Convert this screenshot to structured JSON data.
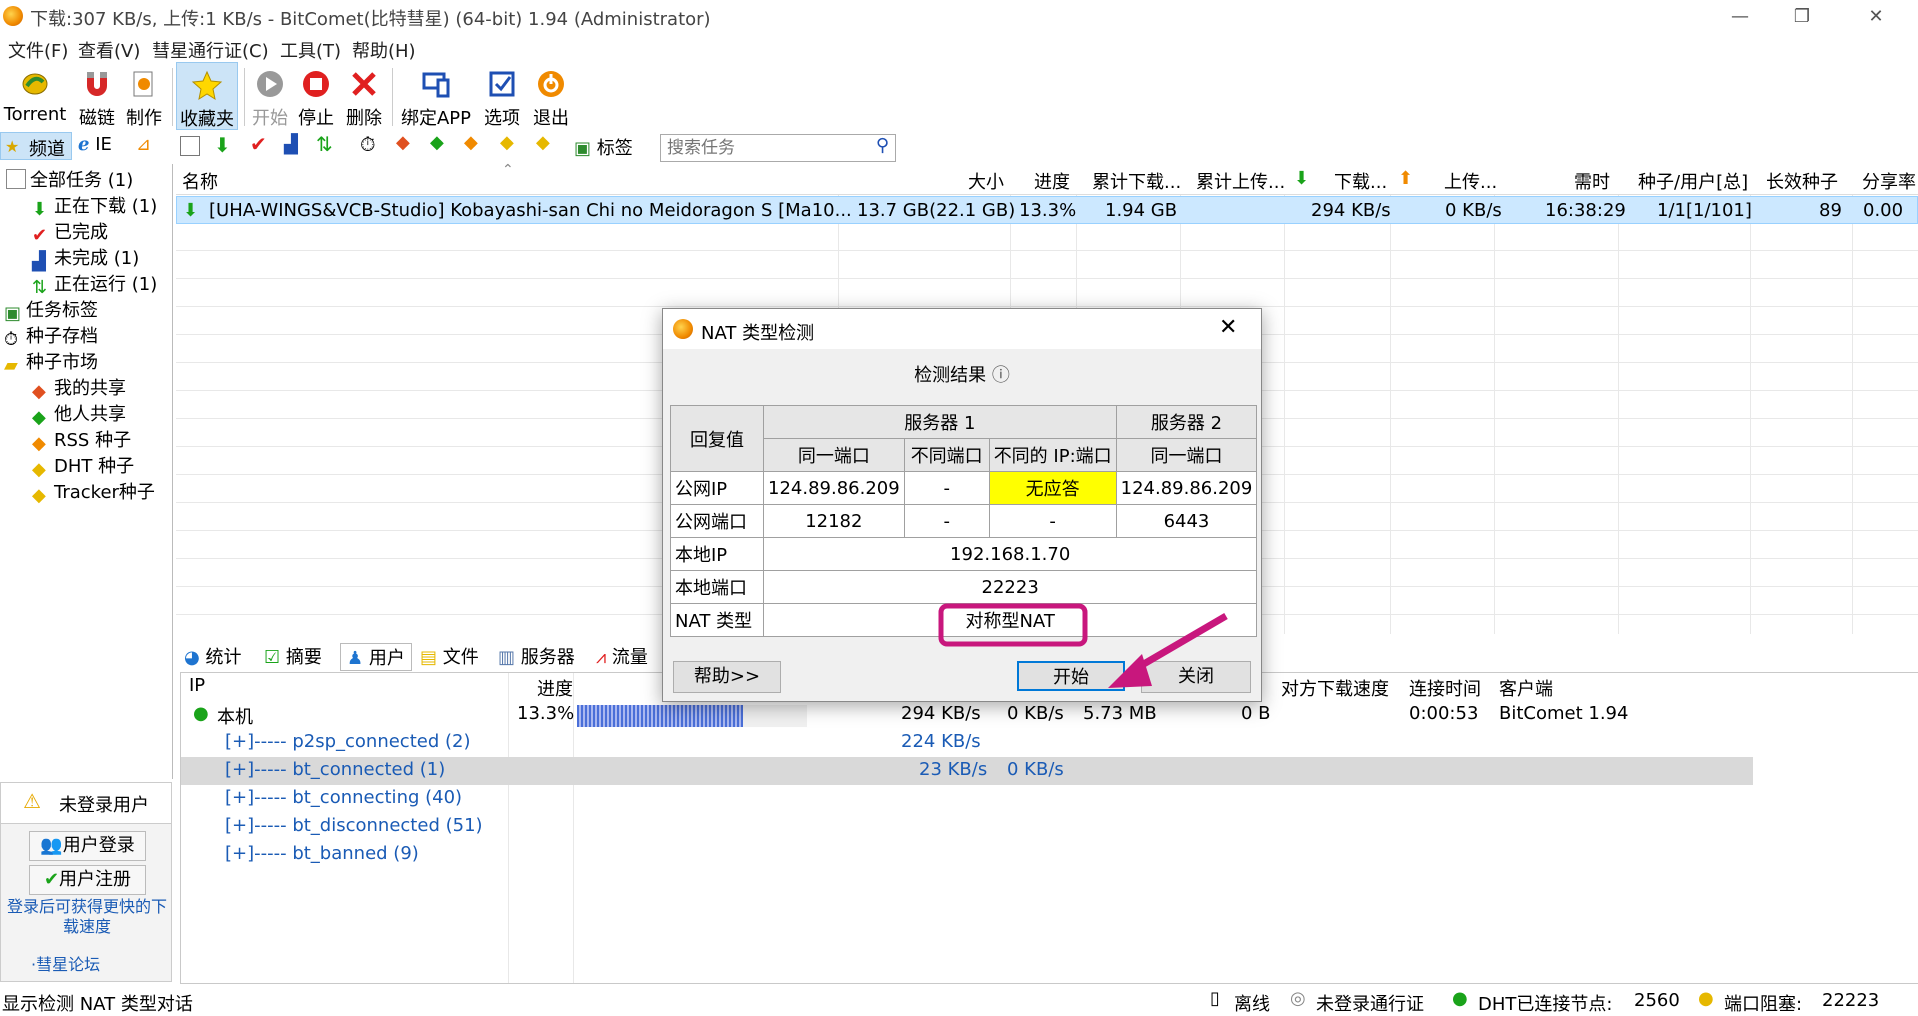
{
  "window": {
    "title": "下载:307 KB/s, 上传:1 KB/s - BitComet(比特彗星) (64-bit) 1.94 (Administrator)",
    "minimize": "—",
    "restore": "❐",
    "close": "✕"
  },
  "menu": [
    "文件(F)",
    "查看(V)",
    "彗星通行证(C)",
    "工具(T)",
    "帮助(H)"
  ],
  "toolbar": {
    "torrent": "Torrent",
    "magnet": "磁链",
    "make": "制作",
    "favorites": "收藏夹",
    "start": "开始",
    "stop": "停止",
    "delete": "删除",
    "bind_app": "绑定APP",
    "options": "选项",
    "exit": "退出"
  },
  "subtoolbar": {
    "channel": "频道",
    "ie": "IE",
    "tag": "标签",
    "search_placeholder": "搜索任务"
  },
  "tree": {
    "all": "全部任务 (1)",
    "downloading": "正在下载 (1)",
    "completed": "已完成",
    "incomplete": "未完成 (1)",
    "running": "正在运行 (1)",
    "task_tags": "任务标签",
    "archive": "种子存档",
    "market": "种子市场",
    "my_share": "我的共享",
    "others_share": "他人共享",
    "rss": "RSS 种子",
    "dht": "DHT 种子",
    "tracker": "Tracker种子"
  },
  "columns": {
    "name": "名称",
    "size": "大小",
    "progress": "进度",
    "total_down": "累计下载...",
    "total_up": "累计上传...",
    "down": "下载...",
    "up": "上传...",
    "eta": "需时",
    "seeds": "种子/用户[总]",
    "long_seeds": "长效种子",
    "ratio": "分享率"
  },
  "task": {
    "name": "[UHA-WINGS&VCB-Studio] Kobayashi-san Chi no Meidoragon S [Ma10...",
    "size": "13.7 GB(22.1 GB)",
    "progress": "13.3%",
    "total_down": "1.94 GB",
    "down": "294 KB/s",
    "up": "0 KB/s",
    "eta": "16:38:29",
    "seeds": "1/1[1/101]",
    "long_seeds": "89",
    "ratio": "0.00"
  },
  "bottom_tabs": [
    "统计",
    "摘要",
    "用户",
    "文件",
    "服务器",
    "流量"
  ],
  "peer_columns": {
    "ip": "IP",
    "progress": "进度",
    "peer_down": "对方下载速度",
    "conn_time": "连接时间",
    "client": "客户端"
  },
  "peers": {
    "local": {
      "name": "本机",
      "progress": "13.3%",
      "down": "294 KB/s",
      "up": "0 KB/s",
      "total": "5.73 MB",
      "zero": "0 B",
      "time": "0:00:53",
      "client": "BitComet 1.94",
      "progress_fraction": 0.72
    },
    "p2sp": {
      "name": "[+]----- p2sp_connected (2)",
      "down": "224 KB/s"
    },
    "bt_connected": {
      "name": "[+]----- bt_connected (1)",
      "down": "23 KB/s",
      "up": "0 KB/s"
    },
    "bt_connecting": {
      "name": "[+]----- bt_connecting (40)"
    },
    "bt_disconnected": {
      "name": "[+]----- bt_disconnected (51)"
    },
    "bt_banned": {
      "name": "[+]----- bt_banned (9)"
    }
  },
  "userpanel": {
    "not_logged": "未登录用户",
    "login": "用户登录",
    "register": "用户注册",
    "tip": "登录后可获得更快的下载速度",
    "forum": "·彗星论坛"
  },
  "status": {
    "left": "显示检测 NAT 类型对话",
    "offline": "离线",
    "passport": "未登录通行证",
    "dht": "DHT已连接节点:",
    "dht_nodes": "2560",
    "port": "端口阻塞:",
    "port_num": "22223"
  },
  "dialog": {
    "title": "NAT 类型检测",
    "result_label": "检测结果",
    "info_icon": "ⓘ",
    "col_reply": "回复值",
    "server1": "服务器 1",
    "server2": "服务器 2",
    "same_port": "同一端口",
    "diff_port": "不同端口",
    "diff_ip_port": "不同的 IP:端口",
    "same_port2": "同一端口",
    "public_ip": "公网IP",
    "public_ip_v1": "124.89.86.209",
    "public_ip_v2": "-",
    "public_ip_v3": "无应答",
    "public_ip_v4": "124.89.86.209",
    "public_port": "公网端口",
    "public_port_v1": "12182",
    "public_port_v2": "-",
    "public_port_v3": "-",
    "public_port_v4": "6443",
    "local_ip": "本地IP",
    "local_ip_v": "192.168.1.70",
    "local_port": "本地端口",
    "local_port_v": "22223",
    "nat_type": "NAT 类型",
    "nat_type_v": "对称型NAT",
    "help_btn": "帮助>>",
    "start_btn": "开始",
    "close_btn": "关闭"
  },
  "colors": {
    "selection": "#cce8ff",
    "highlight_yellow": "#ffff00",
    "annotation": "#c8177d",
    "link_blue": "#1a5bb5"
  }
}
